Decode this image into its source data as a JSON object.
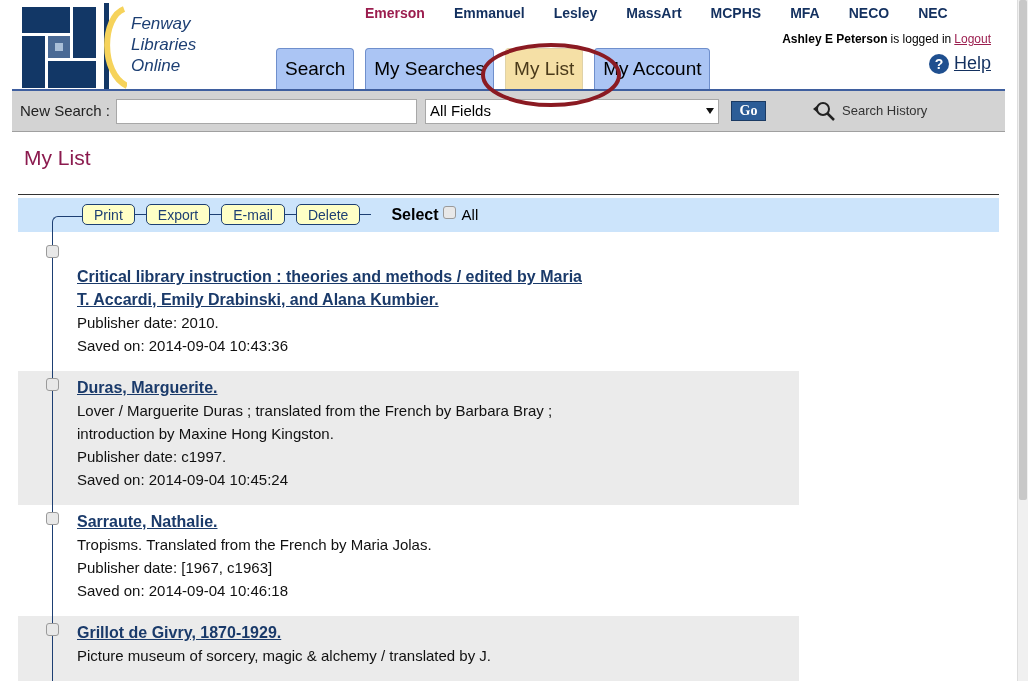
{
  "logo": {
    "lines": [
      "Fenway",
      "Libraries",
      "Online"
    ]
  },
  "libraries": [
    {
      "label": "Emerson",
      "selected": true
    },
    {
      "label": "Emmanuel",
      "selected": false
    },
    {
      "label": "Lesley",
      "selected": false
    },
    {
      "label": "MassArt",
      "selected": false
    },
    {
      "label": "MCPHS",
      "selected": false
    },
    {
      "label": "MFA",
      "selected": false
    },
    {
      "label": "NECO",
      "selected": false
    },
    {
      "label": "NEC",
      "selected": false
    }
  ],
  "user": {
    "name": "Ashley E Peterson",
    "status": "is logged in",
    "logout": "Logout",
    "help_icon": "?",
    "help": "Help"
  },
  "tabs": [
    {
      "label": "Search",
      "selected": false
    },
    {
      "label": "My Searches",
      "selected": false
    },
    {
      "label": "My List",
      "selected": true
    },
    {
      "label": "My Account",
      "selected": false
    }
  ],
  "search": {
    "label": "New Search :",
    "field": "All Fields",
    "go": "Go",
    "history": "Search History"
  },
  "page_title": "My List",
  "toolbar": {
    "buttons": [
      "Print",
      "Export",
      "E-mail",
      "Delete"
    ],
    "select_label": "Select",
    "all_label": "All",
    "all_checked": false
  },
  "items": [
    {
      "title": "Critical library instruction : theories and methods / edited by Maria T. Accardi, Emily Drabinski, and Alana Kumbier.",
      "details": [
        "Publisher date: 2010.",
        "Saved on: 2014-09-04 10:43:36"
      ],
      "checked": false
    },
    {
      "title": "Duras, Marguerite.",
      "details": [
        "Lover / Marguerite Duras ; translated from the French by Barbara Bray ; introduction by Maxine Hong Kingston.",
        "Publisher date: c1997.",
        "Saved on: 2014-09-04 10:45:24"
      ],
      "checked": false
    },
    {
      "title": "Sarraute, Nathalie.",
      "details": [
        "Tropisms. Translated from the French by Maria Jolas.",
        "Publisher date: [1967, c1963]",
        "Saved on: 2014-09-04 10:46:18"
      ],
      "checked": false
    },
    {
      "title": "Grillot de Givry, 1870-1929.",
      "details": [
        "Picture museum of sorcery, magic & alchemy / translated by J."
      ],
      "checked": false
    }
  ]
}
